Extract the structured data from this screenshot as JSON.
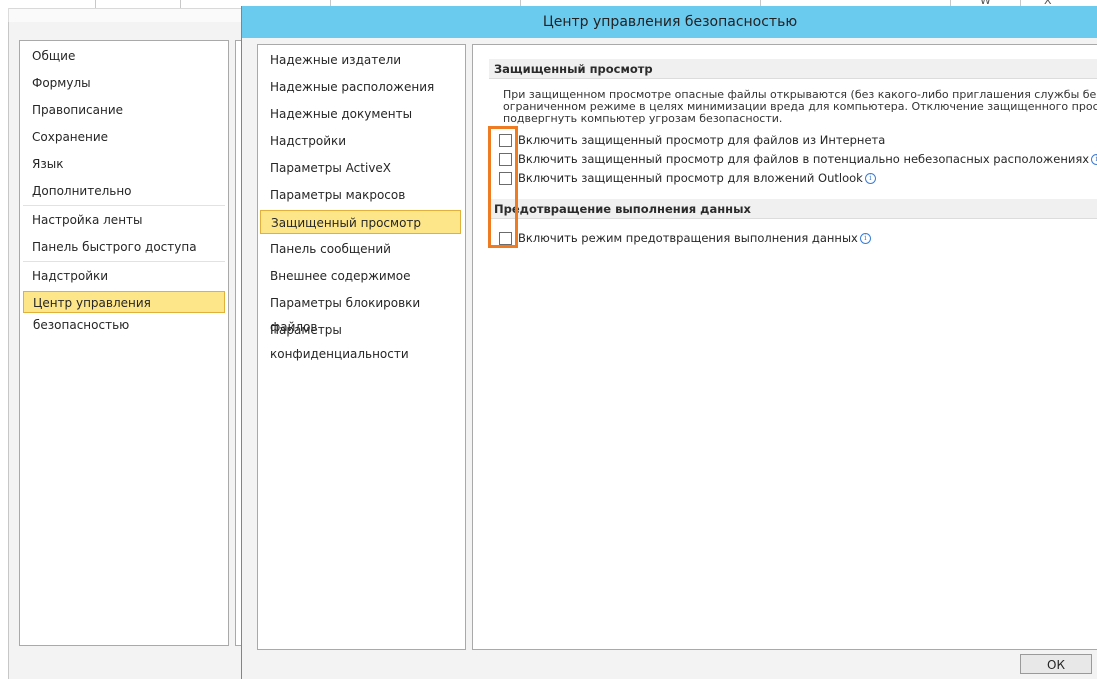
{
  "background": {
    "top_glyphs": [
      "W",
      "X"
    ]
  },
  "options": {
    "nav_items": [
      {
        "label": "Общие"
      },
      {
        "label": "Формулы"
      },
      {
        "label": "Правописание"
      },
      {
        "label": "Сохранение"
      },
      {
        "label": "Язык"
      },
      {
        "label": "Дополнительно"
      },
      {
        "label": "Настройка ленты"
      },
      {
        "label": "Панель быстрого доступа"
      },
      {
        "label": "Надстройки"
      },
      {
        "label": "Центр управления безопасностью",
        "selected": true
      }
    ]
  },
  "trust_center": {
    "title": "Центр управления безопасностью",
    "nav_items": [
      {
        "label": "Надежные издатели"
      },
      {
        "label": "Надежные расположения"
      },
      {
        "label": "Надежные документы"
      },
      {
        "label": "Надстройки"
      },
      {
        "label": "Параметры ActiveX"
      },
      {
        "label": "Параметры макросов"
      },
      {
        "label": "Защищенный просмотр",
        "selected": true
      },
      {
        "label": "Панель сообщений"
      },
      {
        "label": "Внешнее содержимое"
      },
      {
        "label": "Параметры блокировки файлов"
      },
      {
        "label": "Параметры конфиденциальности"
      }
    ],
    "protected_view": {
      "heading": "Защищенный просмотр",
      "description_lines": [
        "При защищенном просмотре опасные файлы открываются (без какого-либо приглашения службы безопаснос",
        "ограниченном режиме в целях минимизации вреда для компьютера. Отключение защищенного просмотра м",
        "подвергнуть компьютер угрозам безопасности."
      ],
      "options": [
        {
          "label": "Включить защищенный просмотр для файлов из Интернета",
          "checked": false,
          "info": false
        },
        {
          "label": "Включить защищенный просмотр для файлов в потенциально небезопасных расположениях",
          "checked": false,
          "info": true
        },
        {
          "label": "Включить защищенный просмотр для вложений Outlook",
          "checked": false,
          "info": true
        }
      ]
    },
    "dep": {
      "heading": "Предотвращение выполнения данных",
      "options": [
        {
          "label": "Включить режим предотвращения выполнения данных",
          "checked": false,
          "info": true
        }
      ]
    },
    "ok_label": "ОК",
    "info_glyph": "i"
  },
  "colors": {
    "title_bar": "#6bcbef",
    "selection": "#fde68a",
    "highlight_box": "#ee7a22"
  }
}
